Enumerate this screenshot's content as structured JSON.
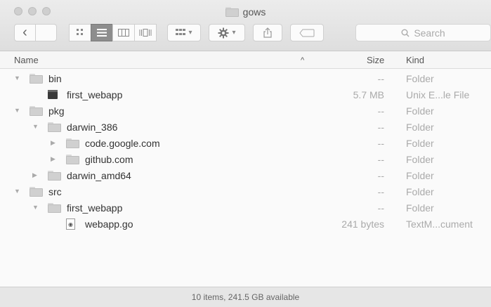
{
  "window": {
    "title": "gows"
  },
  "toolbar": {
    "back_glyph": "‹",
    "arrange_glyph": "▾",
    "action_glyph": "▾",
    "search_placeholder": "Search"
  },
  "columns": {
    "name": "Name",
    "size": "Size",
    "kind": "Kind",
    "sort_glyph": "^"
  },
  "rows": [
    {
      "name": "bin",
      "size": "--",
      "kind": "Folder",
      "depth": 0,
      "icon": "folder-icon",
      "disclosure": "expanded"
    },
    {
      "name": "first_webapp",
      "size": "5.7 MB",
      "kind": "Unix E...le File",
      "depth": 1,
      "icon": "executable-icon",
      "disclosure": "none"
    },
    {
      "name": "pkg",
      "size": "--",
      "kind": "Folder",
      "depth": 0,
      "icon": "folder-icon",
      "disclosure": "expanded"
    },
    {
      "name": "darwin_386",
      "size": "--",
      "kind": "Folder",
      "depth": 1,
      "icon": "folder-icon",
      "disclosure": "expanded"
    },
    {
      "name": "code.google.com",
      "size": "--",
      "kind": "Folder",
      "depth": 2,
      "icon": "folder-icon",
      "disclosure": "collapsed"
    },
    {
      "name": "github.com",
      "size": "--",
      "kind": "Folder",
      "depth": 2,
      "icon": "folder-icon",
      "disclosure": "collapsed"
    },
    {
      "name": "darwin_amd64",
      "size": "--",
      "kind": "Folder",
      "depth": 1,
      "icon": "folder-icon",
      "disclosure": "collapsed"
    },
    {
      "name": "src",
      "size": "--",
      "kind": "Folder",
      "depth": 0,
      "icon": "folder-icon",
      "disclosure": "expanded"
    },
    {
      "name": "first_webapp",
      "size": "--",
      "kind": "Folder",
      "depth": 1,
      "icon": "folder-icon",
      "disclosure": "expanded"
    },
    {
      "name": "webapp.go",
      "size": "241 bytes",
      "kind": "TextM...cument",
      "depth": 2,
      "icon": "document-icon",
      "disclosure": "none"
    }
  ],
  "status": "10 items, 241.5 GB available"
}
